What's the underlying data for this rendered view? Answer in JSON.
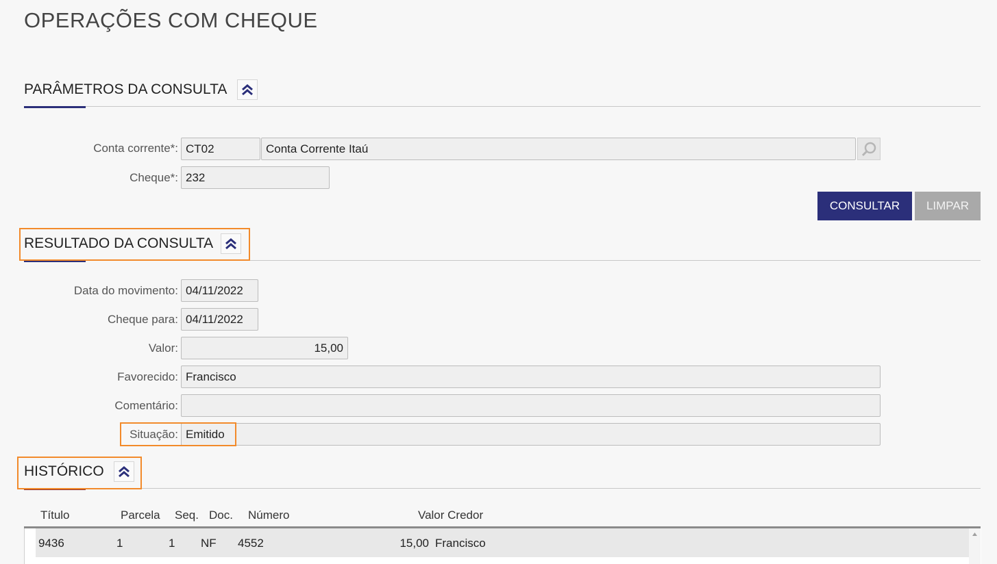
{
  "page": {
    "title": "OPERAÇÕES COM CHEQUE"
  },
  "params": {
    "title": "PARÂMETROS DA CONSULTA",
    "conta_label": "Conta corrente*:",
    "conta_code": "CT02",
    "conta_name": "Conta Corrente Itaú",
    "cheque_label": "Cheque*:",
    "cheque_value": "232",
    "consultar_label": "CONSULTAR",
    "limpar_label": "LIMPAR"
  },
  "result": {
    "title": "RESULTADO DA CONSULTA",
    "data_mov_label": "Data do movimento:",
    "data_mov_value": "04/11/2022",
    "cheque_para_label": "Cheque para:",
    "cheque_para_value": "04/11/2022",
    "valor_label": "Valor:",
    "valor_value": "15,00",
    "favorecido_label": "Favorecido:",
    "favorecido_value": "Francisco",
    "comentario_label": "Comentário:",
    "comentario_value": "",
    "situacao_label": "Situação:",
    "situacao_value": "Emitido"
  },
  "history": {
    "title": "HISTÓRICO",
    "columns": [
      "Título",
      "Parcela",
      "Seq.",
      "Doc.",
      "Número",
      "Valor Credor"
    ],
    "rows": [
      {
        "titulo": "9436",
        "parcela": "1",
        "seq": "1",
        "doc": "NF",
        "numero": "4552",
        "valor": "15,00",
        "credor": "Francisco"
      }
    ]
  },
  "icons": {
    "collapse": "double-chevron-up-icon",
    "search": "magnifier-icon",
    "scroll_up": "scroll-up-arrow-icon"
  },
  "colors": {
    "primary": "#2b2f7a",
    "highlight": "#f28a2a",
    "disabled": "#a9a9a9"
  }
}
